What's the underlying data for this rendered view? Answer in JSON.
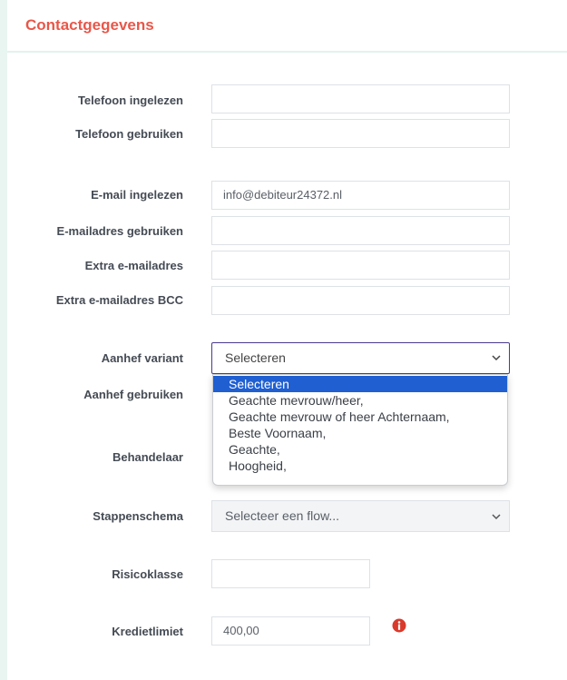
{
  "header": {
    "title": "Contactgegevens"
  },
  "fields": {
    "telefoon_ingelezen": {
      "label": "Telefoon ingelezen",
      "value": ""
    },
    "telefoon_gebruiken": {
      "label": "Telefoon gebruiken",
      "value": ""
    },
    "email_ingelezen": {
      "label": "E-mail ingelezen",
      "value": "info@debiteur24372.nl"
    },
    "emailadres_gebruiken": {
      "label": "E-mailadres gebruiken",
      "value": ""
    },
    "extra_emailadres": {
      "label": "Extra e-mailadres",
      "value": ""
    },
    "extra_emailadres_bcc": {
      "label": "Extra e-mailadres BCC",
      "value": ""
    },
    "aanhef_variant": {
      "label": "Aanhef variant",
      "value": "Selecteren"
    },
    "aanhef_gebruiken": {
      "label": "Aanhef gebruiken"
    },
    "behandelaar": {
      "label": "Behandelaar"
    },
    "stappenschema": {
      "label": "Stappenschema",
      "value": "Selecteer een flow..."
    },
    "risicoklasse": {
      "label": "Risicoklasse",
      "value": ""
    },
    "kredietlimiet": {
      "label": "Kredietlimiet",
      "value": "400,00"
    }
  },
  "aanhef_options": [
    "Selecteren",
    "Geachte mevrouw/heer,",
    "Geachte mevrouw of heer Achternaam,",
    "Beste Voornaam,",
    "Geachte,",
    "Hoogheid,"
  ],
  "colors": {
    "title": "#e8574a",
    "info_icon": "#d93a2b",
    "dropdown_selected": "#1f5fd1"
  },
  "icons": {
    "select_chevron": "chevron-down-icon",
    "kredietlimiet_info": "info-icon"
  }
}
